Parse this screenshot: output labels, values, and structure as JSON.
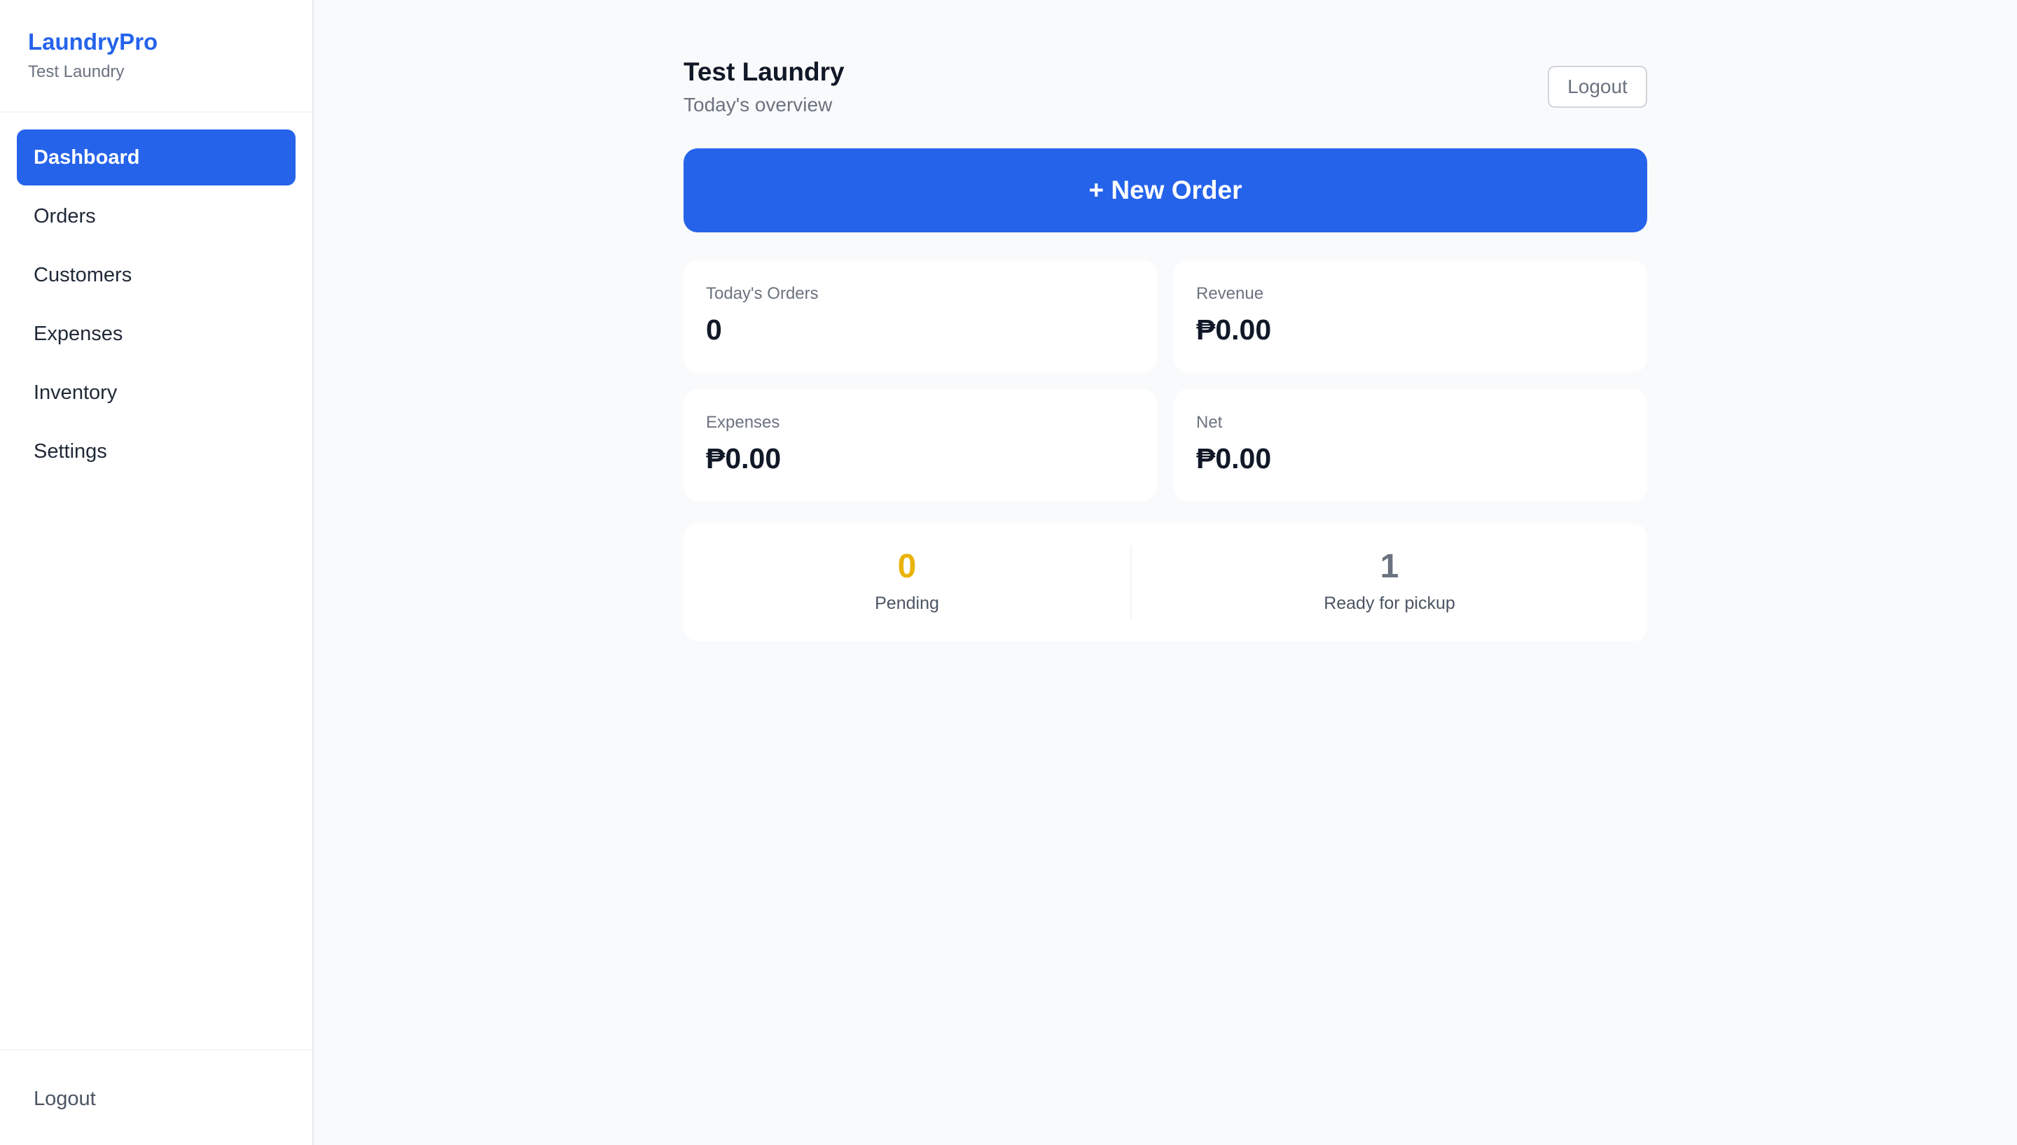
{
  "sidebar": {
    "brand": "LaundryPro",
    "business_name": "Test Laundry",
    "nav": [
      {
        "label": "Dashboard",
        "active": true
      },
      {
        "label": "Orders"
      },
      {
        "label": "Customers"
      },
      {
        "label": "Expenses"
      },
      {
        "label": "Inventory"
      },
      {
        "label": "Settings"
      }
    ],
    "logout_label": "Logout"
  },
  "header": {
    "title": "Test Laundry",
    "subtitle": "Today's overview",
    "logout_label": "Logout"
  },
  "new_order_label": "+ New Order",
  "stats": {
    "todays_orders": {
      "label": "Today's Orders",
      "value": "0"
    },
    "revenue": {
      "label": "Revenue",
      "value": "₱0.00"
    },
    "expenses": {
      "label": "Expenses",
      "value": "₱0.00"
    },
    "net": {
      "label": "Net",
      "value": "₱0.00"
    }
  },
  "status": {
    "pending": {
      "label": "Pending",
      "value": "0"
    },
    "ready": {
      "label": "Ready for pickup",
      "value": "1"
    }
  },
  "colors": {
    "accent": "#2563eb",
    "pending": "#eab308",
    "ready": "#6b7280"
  }
}
